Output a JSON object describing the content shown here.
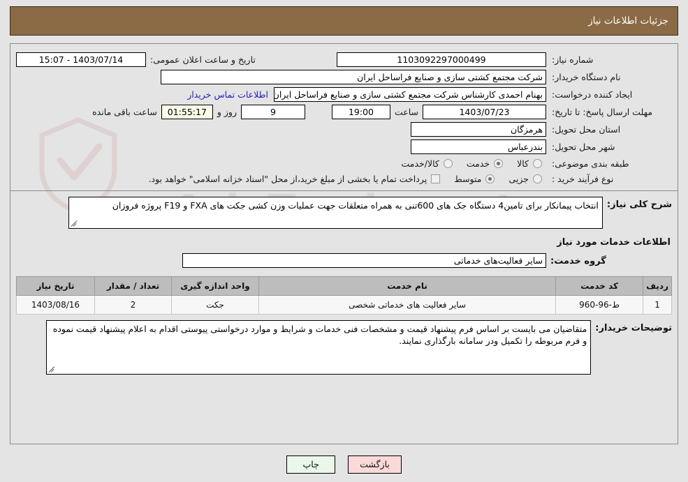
{
  "header": {
    "title": "جزئیات اطلاعات نیاز",
    "bg_color": "#8b6b45",
    "text_color": "#ffffff"
  },
  "watermark": {
    "text": "AriaTender.net",
    "icon": "shield-icon"
  },
  "form": {
    "need_number": {
      "label": "شماره نیاز:",
      "value": "1103092297000499"
    },
    "public_announce": {
      "label": "تاریخ و ساعت اعلان عمومی:",
      "value": "1403/07/14 - 15:07"
    },
    "buyer_org": {
      "label": "نام دستگاه خریدار:",
      "value": "شرکت مجتمع کشتی سازی و صنایع فراساحل ایران",
      "value2": "شرکت مجتمع کشتی سازی و صنایع فراساحل ایران"
    },
    "requester": {
      "label": "ایجاد کننده درخواست:",
      "value": "بهنام احمدی کارشناس شرکت مجتمع کشتی سازی و صنایع فراساحل ایران"
    },
    "contact_link": "اطلاعات تماس خریدار",
    "deadline": {
      "label": "مهلت ارسال پاسخ: تا تاریخ:",
      "date": "1403/07/23",
      "hour_label": "ساعت",
      "hour_value": "19:00",
      "days_value": "9",
      "days_label": "روز و",
      "countdown": "01:55:17",
      "countdown_label": "ساعت باقی مانده"
    },
    "province": {
      "label": "استان محل تحویل:",
      "value": "هرمزگان"
    },
    "city": {
      "label": "شهر محل تحویل:",
      "value": "بندرعباس"
    },
    "category": {
      "label": "طبقه بندی موضوعی:",
      "options": [
        "کالا",
        "خدمت",
        "کالا/خدمت"
      ],
      "selected": "خدمت"
    },
    "process_type": {
      "label": "نوع فرآیند خرید :",
      "options": [
        "جزیی",
        "متوسط"
      ],
      "selected": "متوسط",
      "checkbox_label": "پرداخت تمام یا بخشی از مبلغ خرید،از محل \"اسناد خزانه اسلامی\" خواهد بود.",
      "checkbox_checked": false
    }
  },
  "description": {
    "label": "شرح کلی نیاز:",
    "value": "انتخاب پیمانکار برای تامین4 دستگاه جک های 600تنی  به همراه متعلقات جهت عملیات وزن کشی جکت های FXA و F19  پروژه فروزان"
  },
  "services_section": {
    "heading": "اطلاعات خدمات مورد نیاز",
    "group_label": "گروه خدمت:",
    "group_value": "سایر فعالیت‌های خدماتی"
  },
  "table": {
    "columns": [
      "ردیف",
      "کد خدمت",
      "نام خدمت",
      "واحد اندازه گیری",
      "تعداد / مقدار",
      "تاریخ نیاز"
    ],
    "rows": [
      {
        "row_no": "1",
        "service_code": "ط-96-960",
        "service_name": "سایر فعالیت های خدماتی شخصی",
        "unit": "جکت",
        "quantity": "2",
        "need_date": "1403/08/16"
      }
    ]
  },
  "buyer_notes": {
    "label": "توضیحات خریدار:",
    "value": "متقاضیان می بایست بر اساس فرم پیشنهاد قیمت و مشخصات فنی خدمات و شرایط و موارد درخواستی پیوستی  اقدام به اعلام پیشنهاد قیمت نموده و فرم مربوطه را تکمیل ودر سامانه بارگذاری نمایند."
  },
  "footer": {
    "print_label": "چاپ",
    "back_label": "بازگشت"
  }
}
